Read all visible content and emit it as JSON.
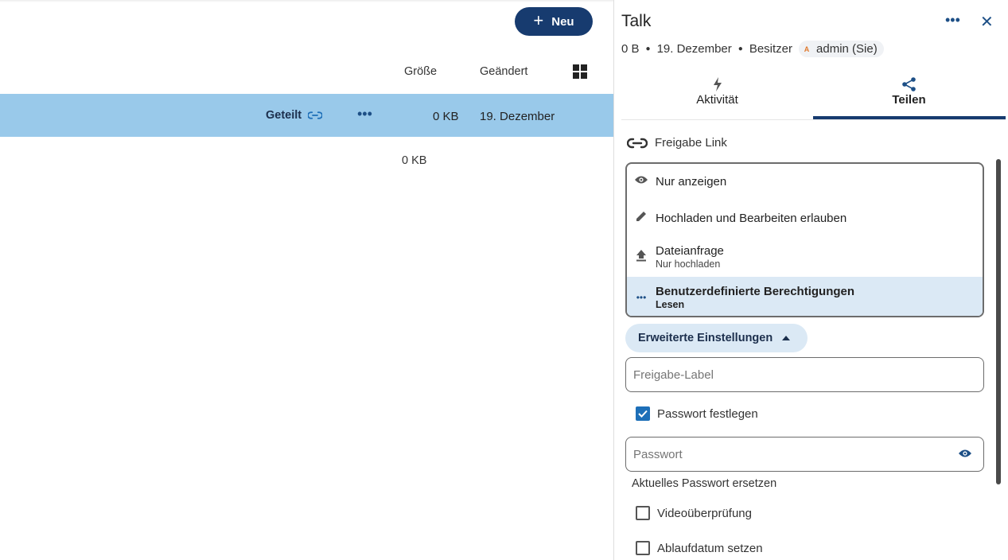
{
  "files": {
    "new_button": "Neu",
    "columns": {
      "size": "Größe",
      "modified": "Geändert"
    },
    "selected_row": {
      "shared_label": "Geteilt",
      "size": "0 KB",
      "modified": "19. Dezember"
    },
    "total_size": "0 KB"
  },
  "sidebar": {
    "title": "Talk",
    "meta": {
      "size": "0 B",
      "date": "19. Dezember",
      "owner_label": "Besitzer",
      "owner_initial": "A",
      "owner_name": "admin (Sie)"
    },
    "tabs": [
      {
        "label": "Aktivität",
        "icon": "lightning-icon"
      },
      {
        "label": "Teilen",
        "icon": "share-icon"
      }
    ],
    "share_link_label": "Freigabe Link",
    "permissions": [
      {
        "label": "Nur anzeigen",
        "icon": "eye-icon"
      },
      {
        "label": "Hochladen und Bearbeiten erlauben",
        "icon": "pencil-icon"
      },
      {
        "label": "Dateianfrage",
        "sub": "Nur hochladen",
        "icon": "upload-icon"
      },
      {
        "label": "Benutzerdefinierte Berechtigungen",
        "sub": "Lesen",
        "icon": "dots-icon",
        "selected": true
      }
    ],
    "advanced_label": "Erweiterte Einstellungen",
    "share_label_placeholder": "Freigabe-Label",
    "set_password_label": "Passwort festlegen",
    "set_password_checked": true,
    "password_placeholder": "Passwort",
    "replace_password_hint": "Aktuelles Passwort ersetzen",
    "video_check_label": "Videoüberprüfung",
    "expiry_label": "Ablaufdatum setzen"
  },
  "colors": {
    "primary": "#173b6f",
    "selected_row": "#99c9ea",
    "light_accent": "#dbe9f5",
    "checkbox": "#1d6fb8"
  }
}
